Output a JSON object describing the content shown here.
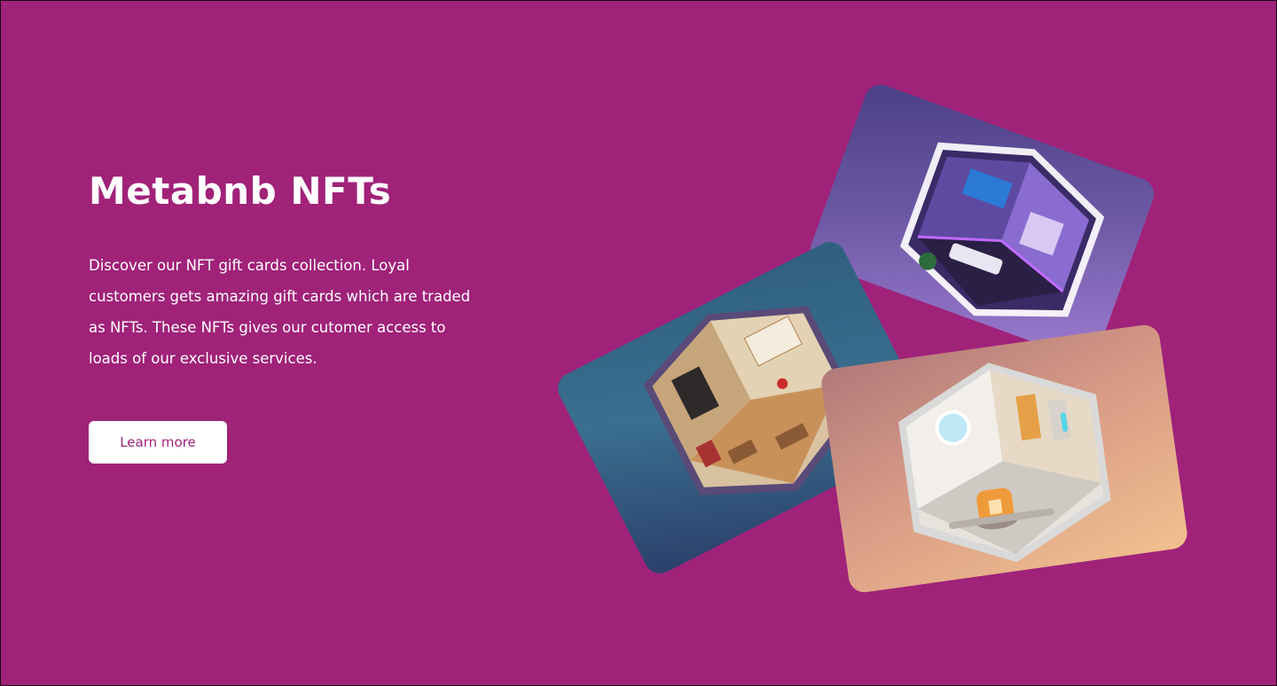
{
  "hero": {
    "title": "Metabnb NFTs",
    "description": "Discover our NFT gift cards collection. Loyal customers gets amazing gift cards which are traded as NFTs. These NFTs gives our cutomer access to loads of our exclusive services.",
    "button_label": "Learn more"
  },
  "colors": {
    "background": "#a02279",
    "button_bg": "#ffffff",
    "button_text": "#a02279"
  },
  "nft_cards": [
    {
      "name": "gaming-room",
      "icon": "gaming-room-isometric"
    },
    {
      "name": "study-room",
      "icon": "study-room-isometric"
    },
    {
      "name": "lab-room",
      "icon": "lab-room-isometric"
    }
  ]
}
